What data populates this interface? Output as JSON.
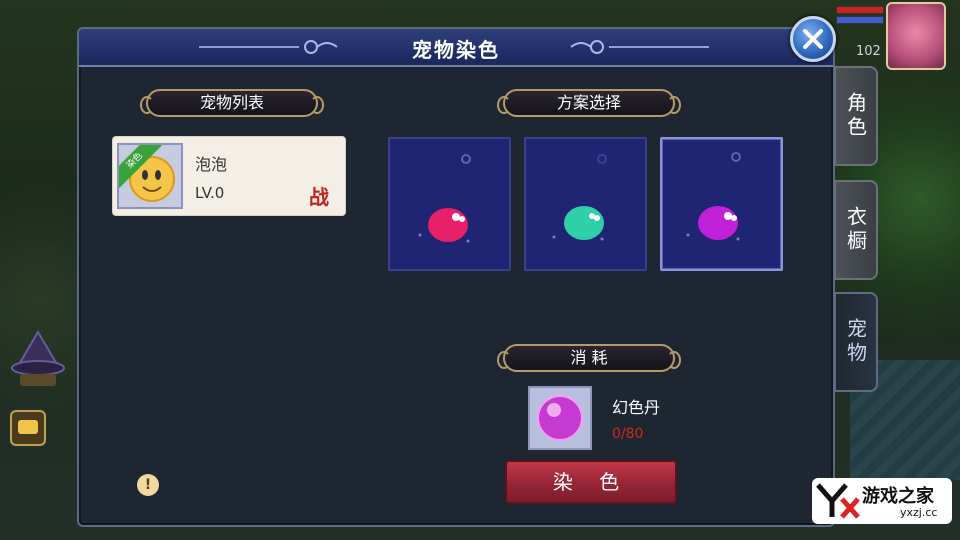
{
  "window": {
    "title": "宠物染色"
  },
  "sections": {
    "pet_list": "宠物列表",
    "scheme_select": "方案选择",
    "cost": "消 耗"
  },
  "pet": {
    "name": "泡泡",
    "level": "LV.0",
    "battle_tag": "战",
    "ribbon": "染色"
  },
  "schemes": [
    {
      "color": "#e8206a",
      "selected": false
    },
    {
      "color": "#2fd0a8",
      "selected": false
    },
    {
      "color": "#c020d8",
      "selected": true
    }
  ],
  "cost": {
    "item_name": "幻色丹",
    "count": "0/80"
  },
  "dye_button": "染 色",
  "side_tabs": [
    {
      "label": "角色",
      "active": false
    },
    {
      "label": "衣橱",
      "active": false
    },
    {
      "label": "宠物",
      "active": true
    }
  ],
  "hud": {
    "number": "102"
  },
  "logo": {
    "main": "游戏之家",
    "sub": "yxzj.cc"
  }
}
